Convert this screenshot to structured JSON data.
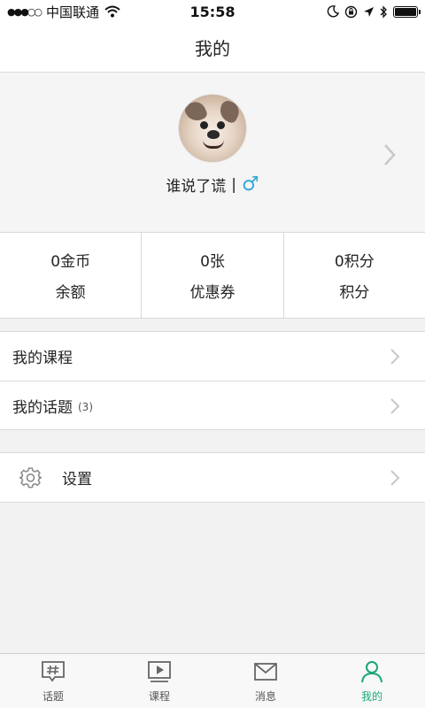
{
  "status_bar": {
    "carrier": "中国联通",
    "signal": "●●●○○",
    "time": "15:58"
  },
  "nav": {
    "title": "我的"
  },
  "profile": {
    "name": "谁说了谎",
    "separator": "|",
    "gender_symbol": "♂",
    "gender_color": "#35a8d6"
  },
  "stats": [
    {
      "value": "0金币",
      "label": "余额"
    },
    {
      "value": "0张",
      "label": "优惠券"
    },
    {
      "value": "0积分",
      "label": "积分"
    }
  ],
  "menu": {
    "my_courses": "我的课程",
    "my_topics": "我的话题",
    "my_topics_count": "(3)",
    "settings": "设置"
  },
  "tabbar": {
    "active_color": "#1aa777",
    "tabs": [
      {
        "label": "话题",
        "icon": "topic-icon"
      },
      {
        "label": "课程",
        "icon": "course-icon"
      },
      {
        "label": "消息",
        "icon": "message-icon"
      },
      {
        "label": "我的",
        "icon": "profile-icon"
      }
    ]
  }
}
